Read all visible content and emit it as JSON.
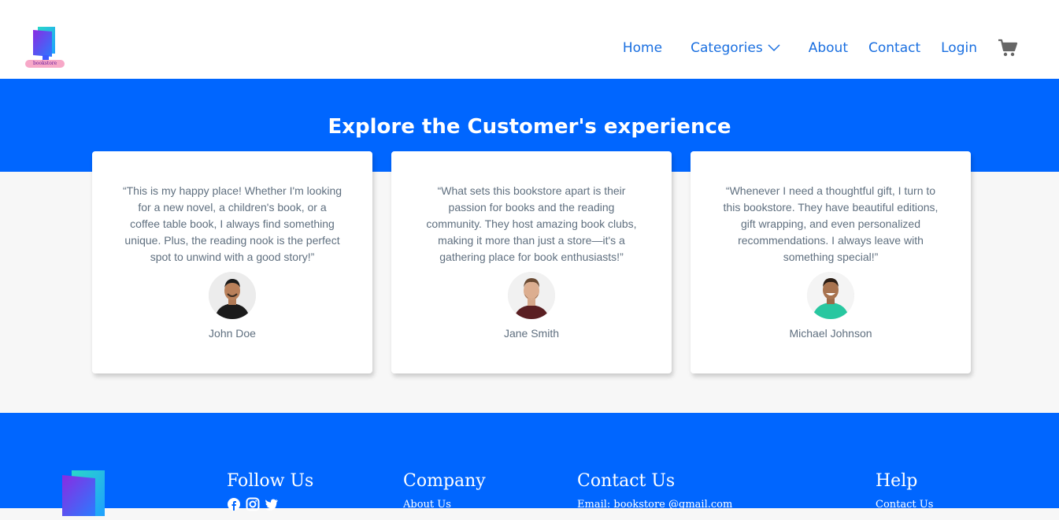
{
  "header": {
    "logo_text": "bookstore",
    "nav": {
      "home": "Home",
      "categories": "Categories",
      "about": "About",
      "contact": "Contact",
      "login": "Login"
    },
    "icons": {
      "categories": "chevron-down-icon",
      "cart": "cart-icon"
    }
  },
  "testimonials": {
    "title": "Explore the Customer's experience",
    "items": [
      {
        "quote": "“This is my happy place! Whether I'm looking for a new novel, a children's book, or a coffee table book, I always find something unique. Plus, the reading nook is the perfect spot to unwind with a good story!”",
        "name": "John Doe"
      },
      {
        "quote": "“What sets this bookstore apart is their passion for books and the reading community. They host amazing book clubs, making it more than just a store—it's a gathering place for book enthusiasts!”",
        "name": "Jane Smith"
      },
      {
        "quote": "“Whenever I need a thoughtful gift, I turn to this bookstore. They have beautiful editions, gift wrapping, and even personalized recommendations. I always leave with something special!”",
        "name": "Michael Johnson"
      }
    ]
  },
  "footer": {
    "follow": {
      "title": "Follow Us",
      "icons": [
        "facebook-icon",
        "instagram-icon",
        "twitter-icon"
      ]
    },
    "company": {
      "title": "Company",
      "first_link": "About Us"
    },
    "contact": {
      "title": "Contact Us",
      "email": "Email: bookstore @gmail.com"
    },
    "help": {
      "title": "Help",
      "first_link": "Contact Us"
    }
  },
  "colors": {
    "primary": "#0066ff",
    "nav_link": "#1a6fe0",
    "text_muted": "#5f6f7f",
    "background": "#f7f7f7"
  }
}
